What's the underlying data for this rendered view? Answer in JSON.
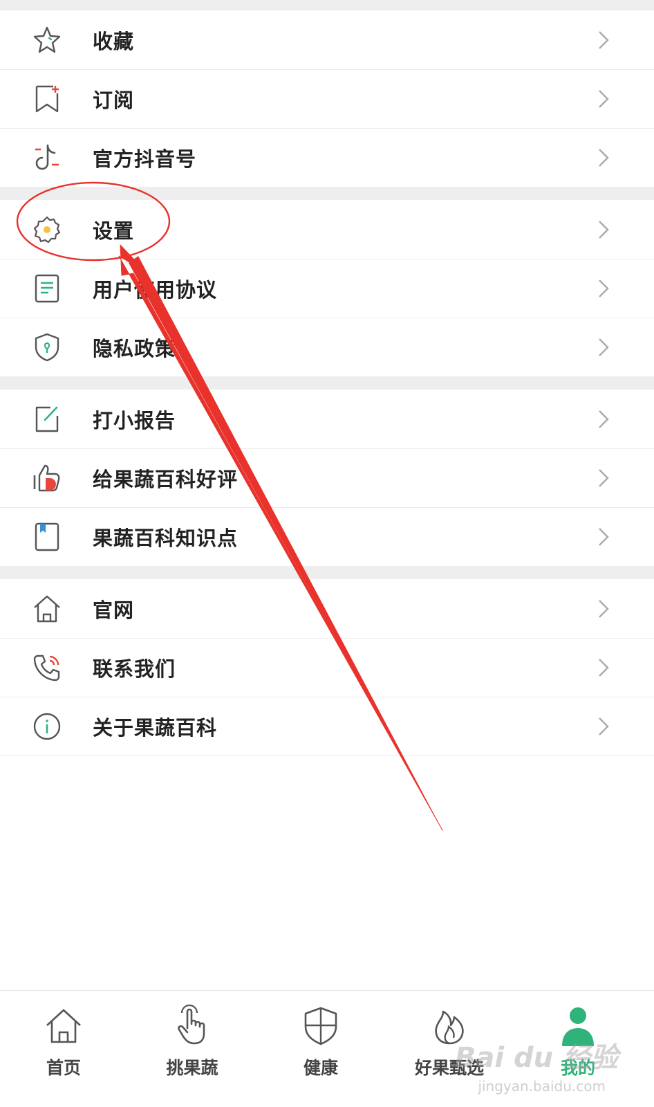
{
  "menu": {
    "group1": [
      {
        "label": "收藏",
        "icon": "star-icon"
      },
      {
        "label": "订阅",
        "icon": "bookmark-add-icon"
      },
      {
        "label": "官方抖音号",
        "icon": "tiktok-icon"
      }
    ],
    "group2": [
      {
        "label": "设置",
        "icon": "gear-icon"
      },
      {
        "label": "用户使用协议",
        "icon": "document-icon"
      },
      {
        "label": "隐私政策",
        "icon": "shield-icon"
      }
    ],
    "group3": [
      {
        "label": "打小报告",
        "icon": "edit-note-icon"
      },
      {
        "label": "给果蔬百科好评",
        "icon": "thumbs-up-icon"
      },
      {
        "label": "果蔬百科知识点",
        "icon": "book-icon"
      }
    ],
    "group4": [
      {
        "label": "官网",
        "icon": "home-icon"
      },
      {
        "label": "联系我们",
        "icon": "phone-icon"
      },
      {
        "label": "关于果蔬百科",
        "icon": "info-icon"
      }
    ]
  },
  "tabbar": {
    "tabs": [
      {
        "label": "首页",
        "icon": "home-icon"
      },
      {
        "label": "挑果蔬",
        "icon": "hand-pointer-icon"
      },
      {
        "label": "健康",
        "icon": "shield-icon"
      },
      {
        "label": "好果甄选",
        "icon": "flame-icon"
      },
      {
        "label": "我的",
        "icon": "user-icon"
      }
    ],
    "active_color": "#2fb37a"
  },
  "watermark": {
    "brand": "Bai du 经验",
    "url": "jingyan.baidu.com"
  },
  "colors": {
    "annotation": "#e8322b",
    "accent_red": "#e8463c",
    "accent_green": "#2fb37a",
    "accent_blue": "#3a8fd6",
    "accent_yellow": "#f5c242"
  }
}
